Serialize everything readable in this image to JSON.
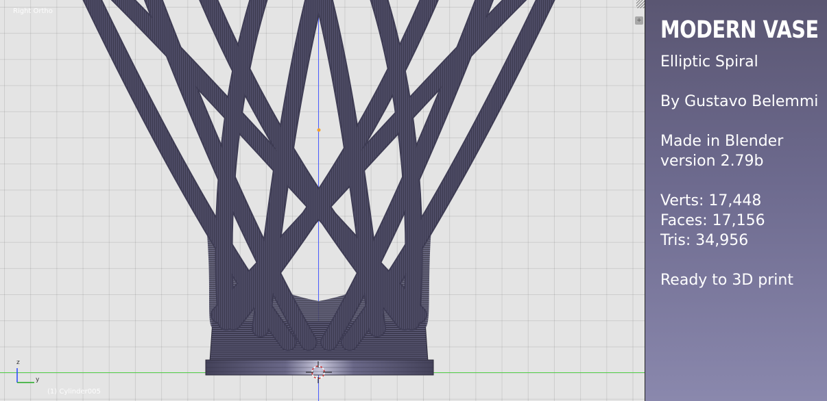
{
  "viewport": {
    "view_label": "Right Ortho",
    "object_label": "(1) Cylinder005",
    "axis_gizmo": {
      "z": "z",
      "y": "y"
    },
    "colors": {
      "grid_bg": "#e4e4e4",
      "mesh": "#4a4860",
      "x_axis": "#55d04a",
      "z_axis": "#4a5cff"
    }
  },
  "panel": {
    "title": "MODERN VASE",
    "subtitle": "Elliptic Spiral",
    "author": "By Gustavo Belemmi",
    "made_in": "Made in Blender",
    "version": "version 2.79b",
    "verts": "Verts: 17,448",
    "faces": "Faces: 17,156",
    "tris": "Tris: 34,956",
    "ready": "Ready to 3D print",
    "colors": {
      "gradient_top": "#5a5672",
      "gradient_bottom": "#8a88ad",
      "text": "#ffffff"
    }
  },
  "icons": [
    "plus-icon",
    "corner-handle-icon",
    "3d-cursor-icon",
    "axis-gizmo-icon"
  ]
}
